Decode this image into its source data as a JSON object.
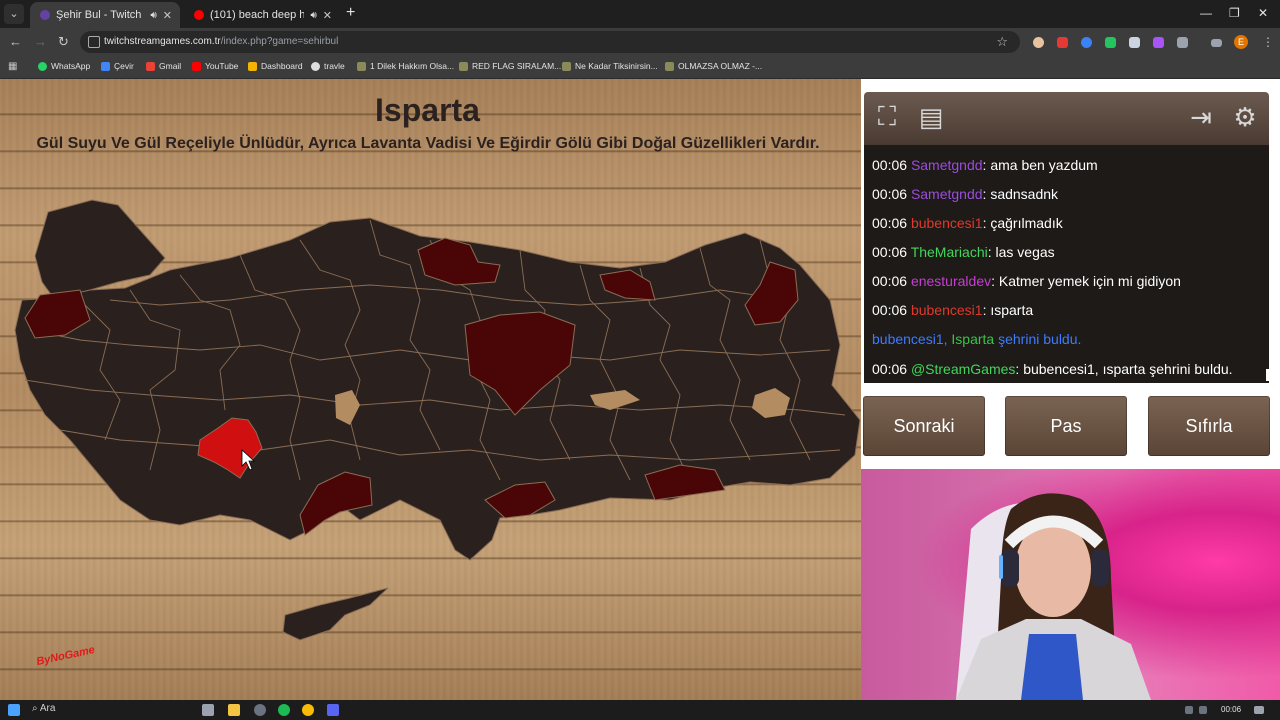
{
  "browser": {
    "tabs": [
      {
        "title": "Şehir Bul - Twitch Stream G",
        "active": true,
        "favicon_color": "#6441a5"
      },
      {
        "title": "(101) beach deep house m",
        "active": false,
        "favicon_color": "#ff0000"
      }
    ],
    "new_tab_symbol": "+",
    "url_host": "twitchstreamgames.com.tr",
    "url_path": "/index.php?game=sehirbul",
    "profile_initial": "E",
    "bookmarks": [
      {
        "label": "WhatsApp",
        "color": "#25d366"
      },
      {
        "label": "Çevir",
        "color": "#4285f4"
      },
      {
        "label": "Gmail",
        "color": "#ea4335"
      },
      {
        "label": "YouTube",
        "color": "#ff0000"
      },
      {
        "label": "Dashboard",
        "color": "#f4b400"
      },
      {
        "label": "travle",
        "color": "#dddddd"
      },
      {
        "label": "1 Dilek Hakkım Olsa...",
        "color": "#8a8a5a"
      },
      {
        "label": "RED FLAG SIRALAM...",
        "color": "#8a8a5a"
      },
      {
        "label": "Ne Kadar Tiksinirsin...",
        "color": "#8a8a5a"
      },
      {
        "label": "OLMAZSA OLMAZ -...",
        "color": "#8a8a5a"
      }
    ]
  },
  "game": {
    "city_name": "Isparta",
    "city_description": "Gül Suyu Ve Gül Reçeliyle Ünlüdür, Ayrıca Lavanta Vadisi Ve Eğirdir Gölü Gibi Doğal Güzellikleri Vardır.",
    "logo_text": "ByNoGame",
    "colors": {
      "province_fill": "#2a211e",
      "province_border": "#8a6d55",
      "found_fill": "#4a0606",
      "current_fill": "#d01010"
    }
  },
  "panel": {
    "chat": [
      {
        "time": "00:06",
        "user": "Sametgndd",
        "user_color": "#9b4ddc",
        "message": "ama ben yazdum"
      },
      {
        "time": "00:06",
        "user": "Sametgndd",
        "user_color": "#9b4ddc",
        "message": "sadnsadnk"
      },
      {
        "time": "00:06",
        "user": "bubencesi1",
        "user_color": "#e0392b",
        "message": "çağrılmadık"
      },
      {
        "time": "00:06",
        "user": "TheMariachi",
        "user_color": "#42d65c",
        "message": "las vegas"
      },
      {
        "time": "00:06",
        "user": "enesturaldev",
        "user_color": "#c53fd1",
        "message": "Katmer yemek için mi gidiyon"
      },
      {
        "time": "00:06",
        "user": "bubencesi1",
        "user_color": "#e0392b",
        "message": "ısparta"
      },
      {
        "system": true,
        "user": "bubencesi1,",
        "user_color": "#3d7bff",
        "city": "Isparta",
        "city_color": "#39c447",
        "message": "şehrini buldu.",
        "message_color": "#3d7bff"
      },
      {
        "time": "00:06",
        "user": "@StreamGames",
        "user_color": "#42d65c",
        "message": "bubencesi1, ısparta şehrini buldu."
      }
    ],
    "buttons": {
      "next": "Sonraki",
      "pass": "Pas",
      "reset": "Sıfırla"
    }
  },
  "taskbar": {
    "search_label": "Ara",
    "clock": "00:06"
  }
}
